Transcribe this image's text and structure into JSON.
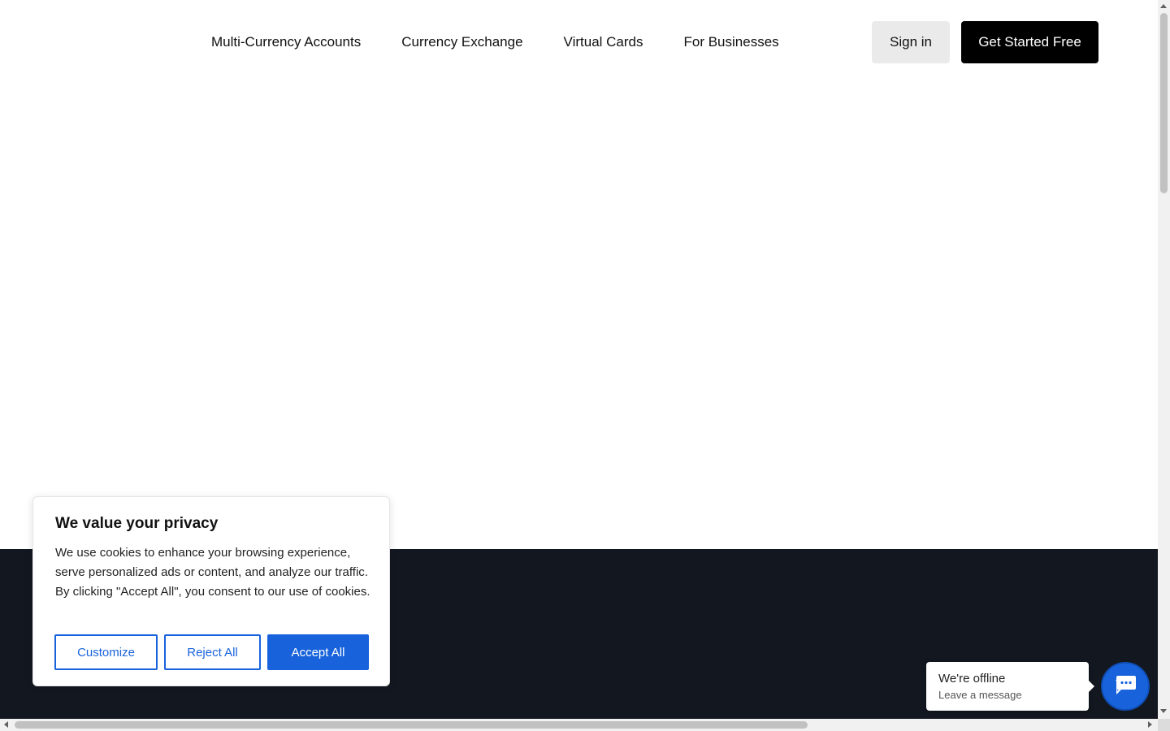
{
  "header": {
    "nav": [
      {
        "label": "Multi-Currency Accounts"
      },
      {
        "label": "Currency Exchange"
      },
      {
        "label": "Virtual Cards"
      },
      {
        "label": "For Businesses"
      }
    ],
    "signin_label": "Sign in",
    "cta_label": "Get Started Free"
  },
  "cookie_banner": {
    "title": "We value your privacy",
    "text": "We use cookies to enhance your browsing experience, serve personalized ads or content, and analyze our traffic. By clicking \"Accept All\", you consent to our use of cookies.",
    "customize_label": "Customize",
    "reject_label": "Reject All",
    "accept_label": "Accept All"
  },
  "chat_widget": {
    "status": "We're offline",
    "subtext": "Leave a message",
    "icon": "chat-icon"
  },
  "colors": {
    "accent": "#1863dc",
    "dark_band": "#131720",
    "cta_bg": "#000000",
    "signin_bg": "#eaeaea"
  }
}
